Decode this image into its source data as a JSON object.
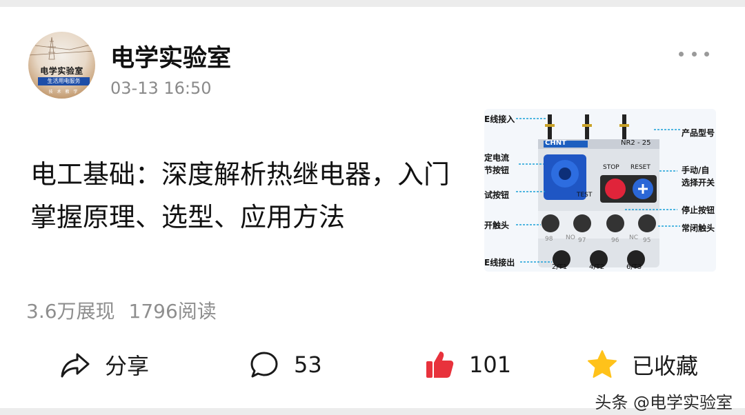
{
  "post": {
    "author": "电学实验室",
    "time": "03-13 16:50",
    "title": "电工基础：深度解析热继电器，入门掌握原理、选型、应用方法",
    "avatar": {
      "title": "电学实验室",
      "subtitle": "生活用电服务",
      "tiny": "技 术 教 学"
    },
    "thumbnail": {
      "labels": {
        "top_left": "E线接入",
        "product": "产品型号",
        "rated_current": "定电流",
        "knob": "节按钮",
        "test_button": "试按钮",
        "normally_open": "开触头",
        "line_out": "E线接出",
        "manual_auto": "手动/自",
        "select": "选择开关",
        "stop_button": "停止按钮",
        "normally_closed": "常闭触头"
      },
      "device": {
        "brand": "CHNT",
        "model": "NR2 - 25",
        "stop": "STOP",
        "reset": "RESET",
        "test": "TEST",
        "terminals_top": [
          "98",
          "NO",
          "97",
          "96",
          "NC",
          "95"
        ],
        "terminals_bottom": [
          "2/T1",
          "4/T2",
          "6/T3"
        ]
      }
    }
  },
  "stats": {
    "impressions": "3.6万展现",
    "reads": "1796阅读"
  },
  "actions": {
    "share": "分享",
    "comments": "53",
    "likes": "101",
    "favorite": "已收藏"
  },
  "colors": {
    "like_red": "#e8323c",
    "star_yellow": "#ffc21a",
    "meta_gray": "#8a8a8a"
  },
  "watermark": "头条 @电学实验室"
}
